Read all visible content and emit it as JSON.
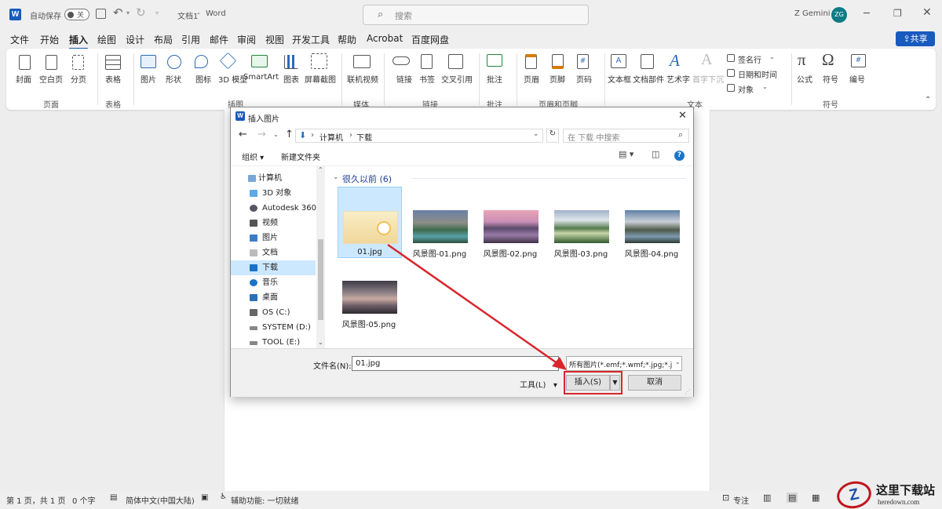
{
  "titlebar": {
    "autosave_label": "自动保存",
    "autosave_state": "关",
    "doc_title": "文档1",
    "app_name": "Word",
    "search_placeholder": "搜索",
    "user_name": "Z Gemini",
    "user_initials": "ZG"
  },
  "menu": {
    "tabs": [
      "文件",
      "开始",
      "插入",
      "绘图",
      "设计",
      "布局",
      "引用",
      "邮件",
      "审阅",
      "视图",
      "开发工具",
      "帮助",
      "Acrobat",
      "百度网盘"
    ],
    "active_index": 2,
    "share_label": "共享"
  },
  "ribbon": {
    "buttons": [
      "封面",
      "空白页",
      "分页",
      "表格",
      "图片",
      "形状",
      "图标",
      "3D 模型",
      "SmartArt",
      "图表",
      "屏幕截图",
      "联机视频",
      "链接",
      "书签",
      "交叉引用",
      "批注",
      "页眉",
      "页脚",
      "页码",
      "文本框",
      "文档部件",
      "艺术字",
      "首字下沉",
      "签名行",
      "日期和时间",
      "对象",
      "公式",
      "符号",
      "编号"
    ],
    "groups": [
      "页面",
      "表格",
      "插图",
      "媒体",
      "链接",
      "批注",
      "页眉和页脚",
      "文本",
      "符号"
    ]
  },
  "dialog": {
    "title": "插入图片",
    "breadcrumb": [
      "计算机",
      "下载"
    ],
    "search_placeholder": "在 下载 中搜索",
    "organize_label": "组织",
    "new_folder_label": "新建文件夹",
    "section_header": "很久以前 (6)",
    "nav_items": [
      "计算机",
      "3D 对象",
      "Autodesk 360",
      "视频",
      "图片",
      "文档",
      "下载",
      "音乐",
      "桌面",
      "OS (C:)",
      "SYSTEM (D:)",
      "TOOL (E:)"
    ],
    "selected_nav_index": 6,
    "files": [
      "01.jpg",
      "风景图-01.png",
      "风景图-02.png",
      "风景图-03.png",
      "风景图-04.png",
      "风景图-05.png"
    ],
    "selected_file_index": 0,
    "filename_label": "文件名(N):",
    "filename_value": "01.jpg",
    "filetype_value": "所有图片(*.emf;*.wmf;*.jpg;*.j",
    "tools_label": "工具(L)",
    "insert_label": "插入(S)",
    "cancel_label": "取消"
  },
  "status": {
    "page_info": "第 1 页，共 1 页",
    "word_count": "0 个字",
    "language": "简体中文(中国大陆)",
    "accessibility": "辅助功能: 一切就绪",
    "focus_label": "专注"
  },
  "watermark": {
    "text": "这里下载站",
    "url": "heredown.com"
  },
  "colors": {
    "accent": "#185abd",
    "highlight_box": "#d9262c",
    "arrow": "#d9262c",
    "selection": "#cce8ff"
  }
}
